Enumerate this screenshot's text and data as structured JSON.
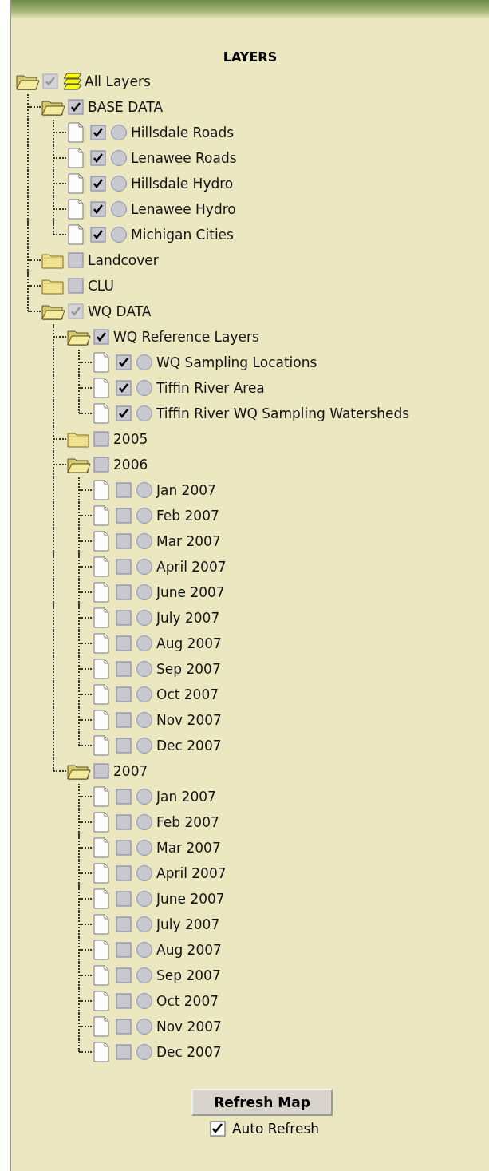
{
  "panel": {
    "title": "LAYERS"
  },
  "tree": [
    {
      "label": "All Layers",
      "kind": "root",
      "expanded": true,
      "checked": true,
      "greyed": true,
      "children": [
        {
          "label": "BASE DATA",
          "kind": "group",
          "expanded": true,
          "checked": true,
          "greyed": false,
          "children": [
            {
              "label": "Hillsdale Roads",
              "kind": "layer",
              "checked": true,
              "greyed": false,
              "selected": false
            },
            {
              "label": "Lenawee Roads",
              "kind": "layer",
              "checked": true,
              "greyed": false,
              "selected": false
            },
            {
              "label": "Hillsdale Hydro",
              "kind": "layer",
              "checked": true,
              "greyed": false,
              "selected": false
            },
            {
              "label": "Lenawee Hydro",
              "kind": "layer",
              "checked": true,
              "greyed": false,
              "selected": false
            },
            {
              "label": "Michigan Cities",
              "kind": "layer",
              "checked": true,
              "greyed": false,
              "selected": false
            }
          ]
        },
        {
          "label": "Landcover",
          "kind": "group",
          "expanded": false,
          "checked": false,
          "greyed": false
        },
        {
          "label": "CLU",
          "kind": "group",
          "expanded": false,
          "checked": false,
          "greyed": false
        },
        {
          "label": "WQ DATA",
          "kind": "group",
          "expanded": true,
          "checked": true,
          "greyed": true,
          "children": [
            {
              "label": "WQ Reference Layers",
              "kind": "group",
              "expanded": true,
              "checked": true,
              "greyed": false,
              "children": [
                {
                  "label": "WQ Sampling Locations",
                  "kind": "layer",
                  "checked": true,
                  "greyed": false,
                  "selected": false
                },
                {
                  "label": "Tiffin River Area",
                  "kind": "layer",
                  "checked": true,
                  "greyed": false,
                  "selected": false
                },
                {
                  "label": "Tiffin River WQ Sampling Watersheds",
                  "kind": "layer",
                  "checked": true,
                  "greyed": false,
                  "selected": false
                }
              ]
            },
            {
              "label": "2005",
              "kind": "group",
              "expanded": false,
              "checked": false,
              "greyed": false
            },
            {
              "label": "2006",
              "kind": "group",
              "expanded": true,
              "checked": false,
              "greyed": false,
              "children": [
                {
                  "label": "Jan 2007",
                  "kind": "layer",
                  "checked": false,
                  "greyed": false,
                  "selected": false
                },
                {
                  "label": "Feb 2007",
                  "kind": "layer",
                  "checked": false,
                  "greyed": false,
                  "selected": false
                },
                {
                  "label": "Mar 2007",
                  "kind": "layer",
                  "checked": false,
                  "greyed": false,
                  "selected": false
                },
                {
                  "label": "April 2007",
                  "kind": "layer",
                  "checked": false,
                  "greyed": false,
                  "selected": false
                },
                {
                  "label": "June 2007",
                  "kind": "layer",
                  "checked": false,
                  "greyed": false,
                  "selected": false
                },
                {
                  "label": "July 2007",
                  "kind": "layer",
                  "checked": false,
                  "greyed": false,
                  "selected": false
                },
                {
                  "label": "Aug 2007",
                  "kind": "layer",
                  "checked": false,
                  "greyed": false,
                  "selected": false
                },
                {
                  "label": "Sep 2007",
                  "kind": "layer",
                  "checked": false,
                  "greyed": false,
                  "selected": false
                },
                {
                  "label": "Oct 2007",
                  "kind": "layer",
                  "checked": false,
                  "greyed": false,
                  "selected": false
                },
                {
                  "label": "Nov 2007",
                  "kind": "layer",
                  "checked": false,
                  "greyed": false,
                  "selected": false
                },
                {
                  "label": "Dec 2007",
                  "kind": "layer",
                  "checked": false,
                  "greyed": false,
                  "selected": false
                }
              ]
            },
            {
              "label": "2007",
              "kind": "group",
              "expanded": true,
              "checked": false,
              "greyed": false,
              "children": [
                {
                  "label": "Jan 2007",
                  "kind": "layer",
                  "checked": false,
                  "greyed": false,
                  "selected": false
                },
                {
                  "label": "Feb 2007",
                  "kind": "layer",
                  "checked": false,
                  "greyed": false,
                  "selected": false
                },
                {
                  "label": "Mar 2007",
                  "kind": "layer",
                  "checked": false,
                  "greyed": false,
                  "selected": false
                },
                {
                  "label": "April 2007",
                  "kind": "layer",
                  "checked": false,
                  "greyed": false,
                  "selected": false
                },
                {
                  "label": "June 2007",
                  "kind": "layer",
                  "checked": false,
                  "greyed": false,
                  "selected": false
                },
                {
                  "label": "July 2007",
                  "kind": "layer",
                  "checked": false,
                  "greyed": false,
                  "selected": false
                },
                {
                  "label": "Aug 2007",
                  "kind": "layer",
                  "checked": false,
                  "greyed": false,
                  "selected": false
                },
                {
                  "label": "Sep 2007",
                  "kind": "layer",
                  "checked": false,
                  "greyed": false,
                  "selected": false
                },
                {
                  "label": "Oct 2007",
                  "kind": "layer",
                  "checked": false,
                  "greyed": false,
                  "selected": false
                },
                {
                  "label": "Nov 2007",
                  "kind": "layer",
                  "checked": false,
                  "greyed": false,
                  "selected": false
                },
                {
                  "label": "Dec 2007",
                  "kind": "layer",
                  "checked": false,
                  "greyed": false,
                  "selected": false
                }
              ]
            }
          ]
        }
      ]
    }
  ],
  "refresh_button": {
    "label": "Refresh Map"
  },
  "auto_refresh": {
    "label": "Auto Refresh",
    "checked": true
  }
}
